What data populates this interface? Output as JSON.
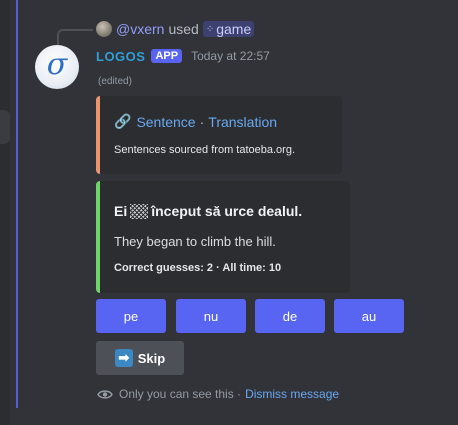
{
  "reply": {
    "username": "@vxern",
    "used_text": "used",
    "command_name": "game"
  },
  "message": {
    "author": "LOGOS",
    "app_badge": "APP",
    "timestamp": "Today at 22:57",
    "edited_label": "(edited)",
    "avatar_glyph": "σ"
  },
  "source_embed": {
    "link_icon": "🔗",
    "title_link_1": "Sentence",
    "separator": "·",
    "title_link_2": "Translation",
    "description": "Sentences sourced from tatoeba.org.",
    "stripe_color": "#e8966f"
  },
  "game_embed": {
    "sentence_before": "Ei",
    "sentence_after": "început să urce dealul.",
    "translation": "They began to climb the hill.",
    "footer": "Correct guesses: 2 · All time: 10",
    "stripe_color": "#72d36b"
  },
  "answer_buttons": [
    "pe",
    "nu",
    "de",
    "au"
  ],
  "skip_button": {
    "icon": "➡",
    "label": "Skip"
  },
  "ephemeral_note": {
    "text": "Only you can see this ·",
    "dismiss_label": "Dismiss message"
  },
  "colors": {
    "background": "#313338",
    "accent": "#5865f2",
    "link": "#6aa8f0"
  }
}
